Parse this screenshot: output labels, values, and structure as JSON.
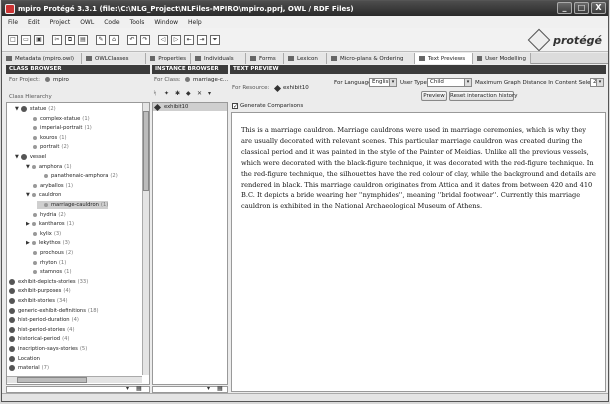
{
  "window": {
    "title": "mpiro Protégé 3.3.1    (file:\\C:\\NLG_Project\\NLFiles-MPIRO\\mpiro.pprj, OWL / RDF Files)",
    "minimize": "_",
    "maximize": "□",
    "close": "X"
  },
  "menu": [
    "File",
    "Edit",
    "Project",
    "OWL",
    "Code",
    "Tools",
    "Window",
    "Help"
  ],
  "logo": {
    "text": "protégé"
  },
  "tabs": [
    {
      "label": "Metadata (mpiro.owl)",
      "icon": "metadata-icon"
    },
    {
      "label": "OWLClasses",
      "icon": "classes-icon"
    },
    {
      "label": "Properties",
      "icon": "properties-icon"
    },
    {
      "label": "Individuals",
      "icon": "individuals-icon"
    },
    {
      "label": "Forms",
      "icon": "forms-icon"
    },
    {
      "label": "Lexicon",
      "icon": "lexicon-icon"
    },
    {
      "label": "Micro-plans & Ordering",
      "icon": "microplans-icon"
    },
    {
      "label": "Text Previews",
      "icon": "text-previews-icon"
    },
    {
      "label": "User Modelling",
      "icon": "user-modelling-icon"
    }
  ],
  "class_browser": {
    "header": "CLASS BROWSER",
    "for_project_label": "For Project:",
    "project_name": "mpiro",
    "hierarchy_label": "Class Hierarchy",
    "tree": [
      {
        "label": "statue",
        "count": "(2)",
        "depth": 0,
        "toggle": "▼"
      },
      {
        "label": "complex-statue",
        "count": "(1)",
        "depth": 1,
        "toggle": ""
      },
      {
        "label": "imperial-portrait",
        "count": "(1)",
        "depth": 1,
        "toggle": ""
      },
      {
        "label": "kouros",
        "count": "(1)",
        "depth": 1,
        "toggle": ""
      },
      {
        "label": "portrait",
        "count": "(2)",
        "depth": 1,
        "toggle": ""
      },
      {
        "label": "vessel",
        "count": "",
        "depth": 0,
        "toggle": "▼"
      },
      {
        "label": "amphora",
        "count": "(1)",
        "depth": 1,
        "toggle": "▼"
      },
      {
        "label": "panathenaic-amphora",
        "count": "(2)",
        "depth": 2,
        "toggle": ""
      },
      {
        "label": "aryballos",
        "count": "(1)",
        "depth": 1,
        "toggle": ""
      },
      {
        "label": "cauldron",
        "count": "",
        "depth": 1,
        "toggle": "▼"
      },
      {
        "label": "marriage-cauldron",
        "count": "(1)",
        "depth": 2,
        "toggle": "",
        "selected": true
      },
      {
        "label": "hydria",
        "count": "(2)",
        "depth": 1,
        "toggle": ""
      },
      {
        "label": "kantharos",
        "count": "(1)",
        "depth": 1,
        "toggle": "▶"
      },
      {
        "label": "kylix",
        "count": "(3)",
        "depth": 1,
        "toggle": ""
      },
      {
        "label": "lekythos",
        "count": "(3)",
        "depth": 1,
        "toggle": "▶"
      },
      {
        "label": "prochous",
        "count": "(2)",
        "depth": 1,
        "toggle": ""
      },
      {
        "label": "rhyton",
        "count": "(1)",
        "depth": 1,
        "toggle": ""
      },
      {
        "label": "stamnos",
        "count": "(1)",
        "depth": 1,
        "toggle": ""
      },
      {
        "label": "exhibit-depicts-stories",
        "count": "(33)",
        "depth": -1,
        "toggle": ""
      },
      {
        "label": "exhibit-purposes",
        "count": "(4)",
        "depth": -1,
        "toggle": ""
      },
      {
        "label": "exhibit-stories",
        "count": "(34)",
        "depth": -1,
        "toggle": ""
      },
      {
        "label": "generic-exhibit-definitions",
        "count": "(18)",
        "depth": -1,
        "toggle": ""
      },
      {
        "label": "hist-period-duration",
        "count": "(4)",
        "depth": -1,
        "toggle": ""
      },
      {
        "label": "hist-period-stories",
        "count": "(4)",
        "depth": -1,
        "toggle": ""
      },
      {
        "label": "historical-period",
        "count": "(4)",
        "depth": -1,
        "toggle": ""
      },
      {
        "label": "inscription-says-stories",
        "count": "(5)",
        "depth": -1,
        "toggle": ""
      },
      {
        "label": "Location",
        "count": "",
        "depth": -1,
        "toggle": ""
      },
      {
        "label": "material",
        "count": "(7)",
        "depth": -1,
        "toggle": ""
      }
    ]
  },
  "instance_browser": {
    "header": "INSTANCE BROWSER",
    "for_class_label": "For Class:",
    "class_name": "marriage-c...",
    "instances": [
      "exhibit10"
    ]
  },
  "text_preview": {
    "header": "TEXT PREVIEW",
    "for_resource_label": "For Resource:",
    "resource_name": "exhibit10",
    "language_label": "For Language",
    "language_value": "English",
    "user_type_label": "User Type",
    "user_type_value": "Child",
    "max_distance_label": "Maximum Graph Distance In Content Selection",
    "max_distance_value": "2",
    "preview_button": "Preview",
    "reset_button": "Reset interaction history",
    "generate_comparisons_label": "Generate Comparisons",
    "generate_comparisons_checked": true,
    "text": "This is a marriage cauldron. Marriage cauldrons were used in marriage ceremonies, which is why they are usually decorated with relevant scenes. This particular marriage cauldron was created during the classical period and it was painted in the style of the Painter of Meidias. Unlike all the previous vessels, which were decorated with the black-figure technique, it was decorated with the red-figure technique. In the red-figure technique, the silhouettes have the red colour of clay, while the background and details are rendered in black. This marriage cauldron originates from Attica and it dates from between 420 and 410 B.C. It depicts a bride wearing her ''nymphides'', meaning ''bridal footwear''. Currently this marriage cauldron is exhibited in the National Archaeological Museum of Athens."
  }
}
